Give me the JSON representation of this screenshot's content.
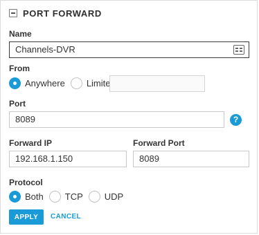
{
  "header": {
    "title": "PORT FORWARD",
    "collapse_icon": "minus-square-icon"
  },
  "name": {
    "label": "Name",
    "value": "Channels-DVR",
    "icon": "id-card-icon"
  },
  "from": {
    "label": "From",
    "options": [
      {
        "label": "Anywhere",
        "selected": true
      },
      {
        "label": "Limited",
        "selected": false
      }
    ],
    "limited_value": ""
  },
  "port": {
    "label": "Port",
    "value": "8089",
    "help_icon": "?"
  },
  "forward_ip": {
    "label": "Forward IP",
    "value": "192.168.1.150"
  },
  "forward_port": {
    "label": "Forward Port",
    "value": "8089"
  },
  "protocol": {
    "label": "Protocol",
    "options": [
      {
        "label": "Both",
        "selected": true
      },
      {
        "label": "TCP",
        "selected": false
      },
      {
        "label": "UDP",
        "selected": false
      }
    ]
  },
  "actions": {
    "apply": "APPLY",
    "cancel": "CANCEL"
  },
  "colors": {
    "accent": "#1a9bd7",
    "border": "#c9c9c9"
  }
}
